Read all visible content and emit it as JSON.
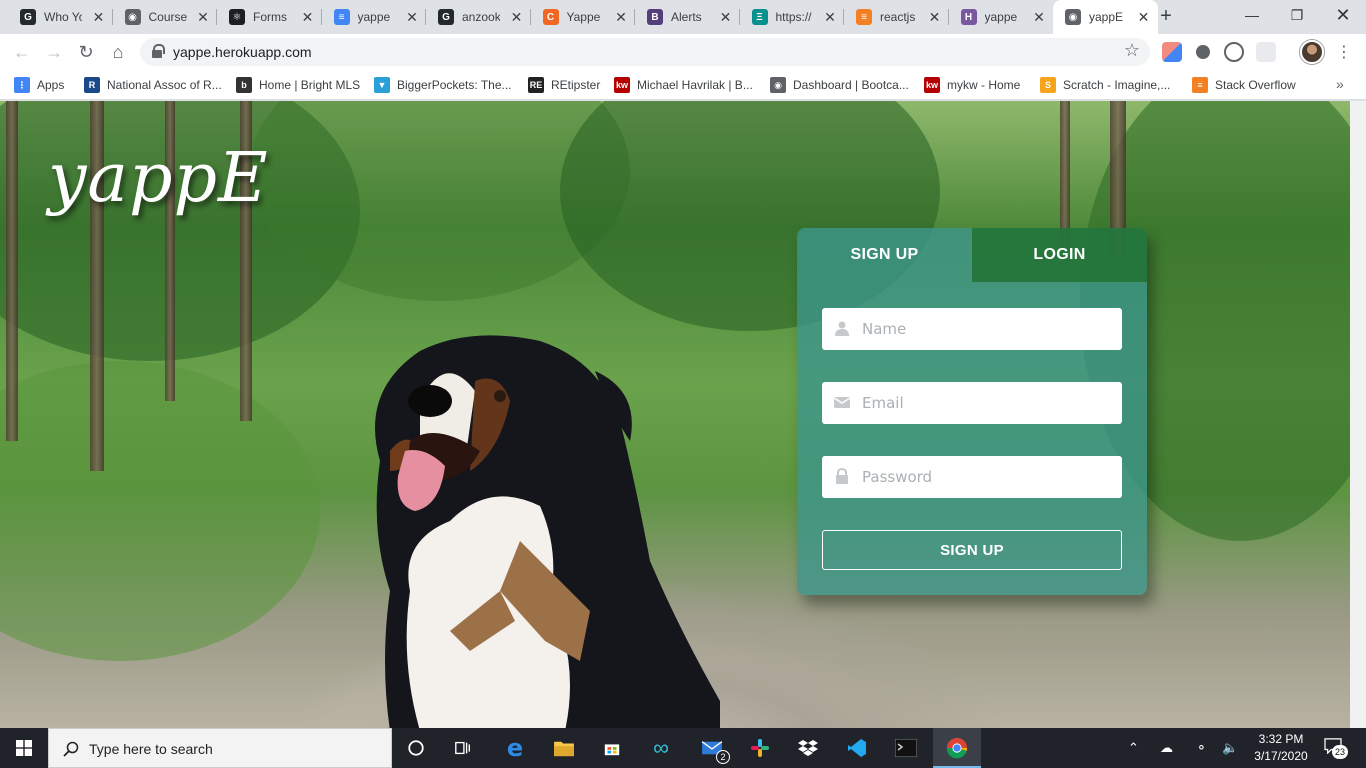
{
  "browser": {
    "tabs": [
      {
        "title": "Who Yo",
        "color": "#24292e",
        "glyph": "G"
      },
      {
        "title": "Course",
        "color": "#5f6368",
        "glyph": "◉"
      },
      {
        "title": "Forms",
        "color": "#1b1f24",
        "glyph": "⚛"
      },
      {
        "title": "yappe",
        "color": "#4285f4",
        "glyph": "≡"
      },
      {
        "title": "anzook",
        "color": "#24292e",
        "glyph": "G"
      },
      {
        "title": "Yappe",
        "color": "#f26522",
        "glyph": "C"
      },
      {
        "title": "Alerts",
        "color": "#563d7c",
        "glyph": "B"
      },
      {
        "title": "https://",
        "color": "#0a8f8f",
        "glyph": "Ξ"
      },
      {
        "title": "reactjs",
        "color": "#f48024",
        "glyph": "≡"
      },
      {
        "title": "yappe",
        "color": "#79589f",
        "glyph": "H"
      },
      {
        "title": "yappE",
        "color": "#5f6368",
        "glyph": "◉"
      }
    ],
    "active_tab": 10,
    "url": "yappe.herokuapp.com",
    "bookmarks": [
      {
        "label": "Apps",
        "color": "#4285f4",
        "glyph": "⋮"
      },
      {
        "label": "National Assoc of R...",
        "color": "#1a4a8a",
        "glyph": "R"
      },
      {
        "label": "Home | Bright MLS",
        "color": "#333333",
        "glyph": "b"
      },
      {
        "label": "BiggerPockets: The...",
        "color": "#2a9fd8",
        "glyph": "▼"
      },
      {
        "label": "REtipster",
        "color": "#222222",
        "glyph": "RE"
      },
      {
        "label": "Michael Havrilak | B...",
        "color": "#b40101",
        "glyph": "kw"
      },
      {
        "label": "Dashboard | Bootca...",
        "color": "#5f6368",
        "glyph": "◉"
      },
      {
        "label": "mykw - Home",
        "color": "#b40101",
        "glyph": "kw"
      },
      {
        "label": "Scratch - Imagine,...",
        "color": "#f7a41d",
        "glyph": "S"
      },
      {
        "label": "Stack Overflow",
        "color": "#f48024",
        "glyph": "≡"
      }
    ]
  },
  "page": {
    "logo": "yappE",
    "tabs": {
      "signup": "SIGN UP",
      "login": "LOGIN"
    },
    "fields": {
      "name_placeholder": "Name",
      "email_placeholder": "Email",
      "password_placeholder": "Password"
    },
    "submit_label": "SIGN UP"
  },
  "taskbar": {
    "search_placeholder": "Type here to search",
    "mail_badge": "2",
    "time": "3:32 PM",
    "date": "3/17/2020",
    "notification_count": "23"
  },
  "colors": {
    "card": "#3c968c",
    "login_tab": "#1e6e28",
    "taskbar": "#20242a"
  }
}
